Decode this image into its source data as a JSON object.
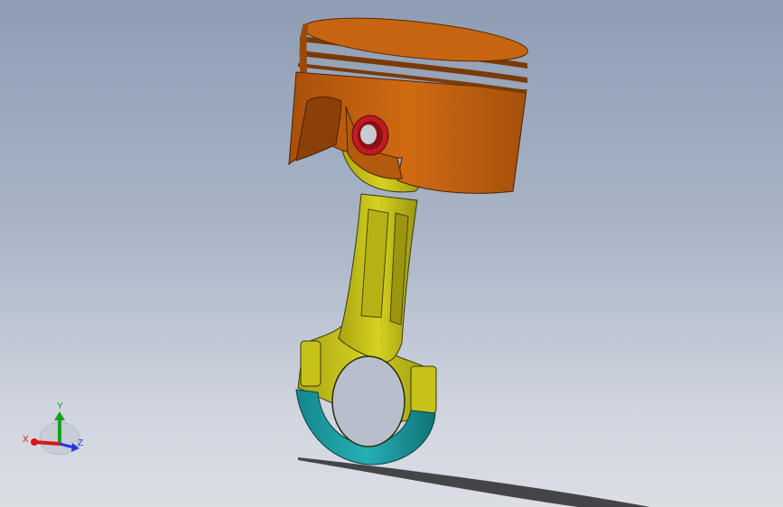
{
  "viewport": {
    "background_top": "#8f9db4",
    "background_bottom": "#dcdee4"
  },
  "model": {
    "parts": [
      "piston",
      "piston-pin",
      "connecting-rod",
      "rod-cap"
    ],
    "colors": {
      "piston": "#c2600e",
      "piston_dark": "#8a3f08",
      "pin": "#d0202a",
      "rod": "#c8c418",
      "rod_dark": "#8a8610",
      "cap": "#1a9a9e",
      "cap_dark": "#0e6a70"
    }
  },
  "triad": {
    "x_label": "X",
    "y_label": "Y",
    "z_label": "Z",
    "x_color": "#e02020",
    "y_color": "#20a020",
    "z_color": "#2040e0"
  }
}
